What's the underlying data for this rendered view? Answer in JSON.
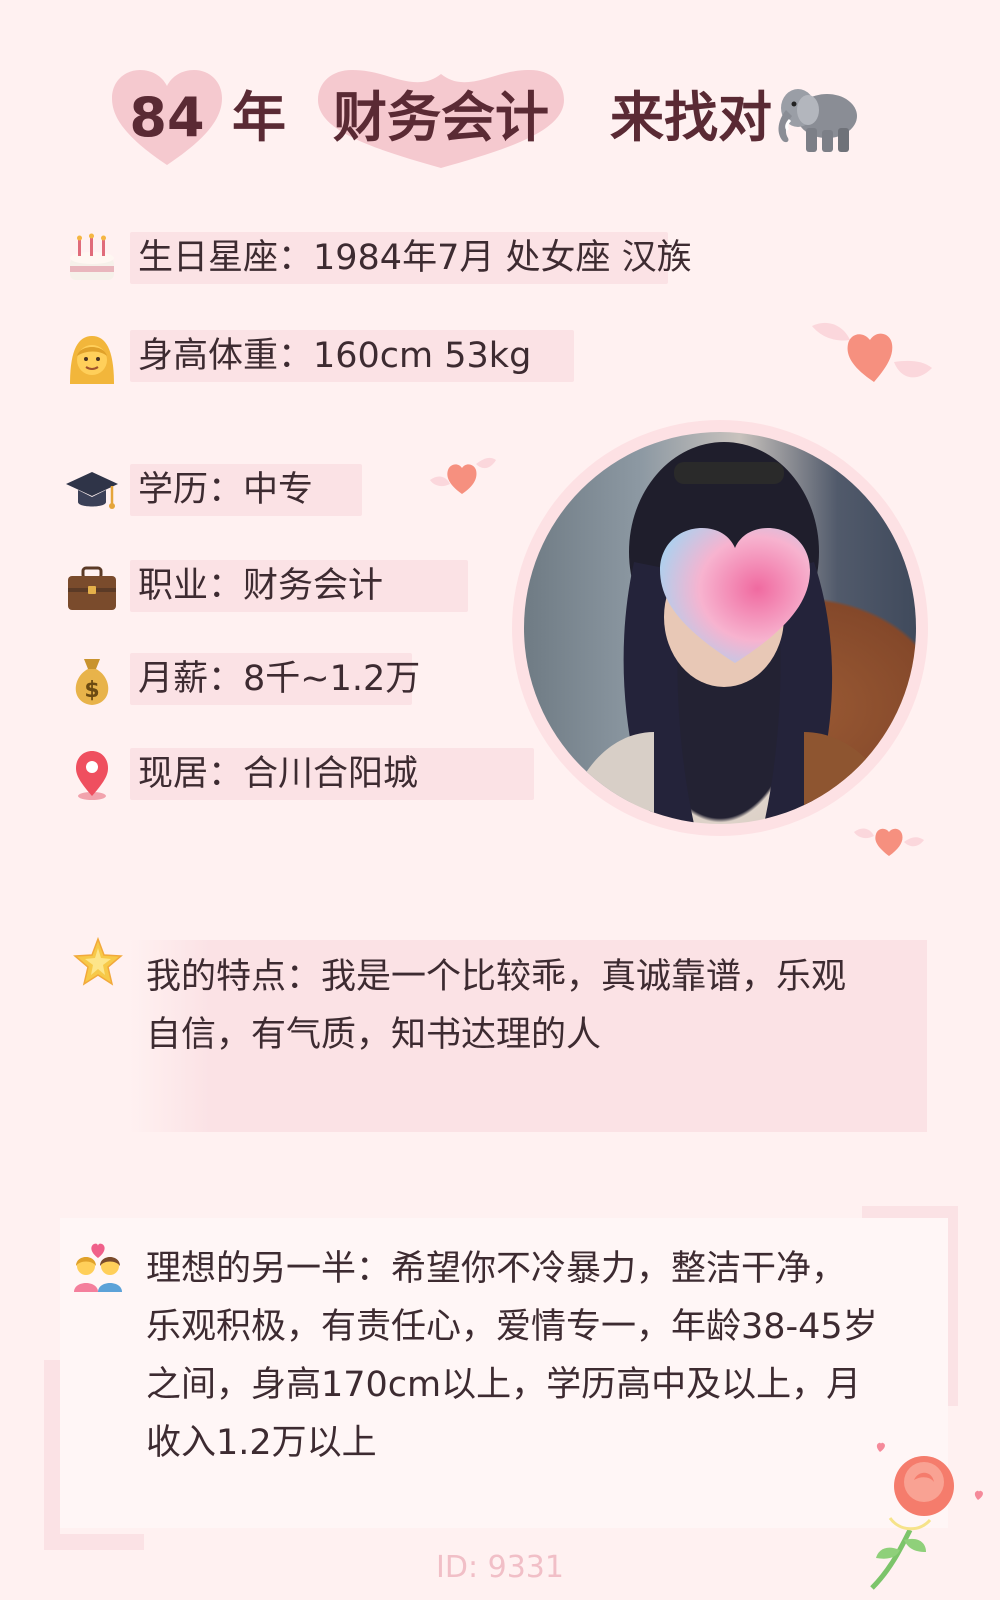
{
  "header": {
    "year": "84",
    "year_suffix": "年",
    "job": "财务会计",
    "tail": "来找对",
    "tail_icon": "elephant-icon"
  },
  "info": [
    {
      "icon": "birthday-cake-icon",
      "text": "生日星座：1984年7月 处女座 汉族"
    },
    {
      "icon": "woman-icon",
      "text": "身高体重：160cm 53kg"
    },
    {
      "icon": "graduation-cap-icon",
      "text": "学历：中专"
    },
    {
      "icon": "briefcase-icon",
      "text": "职业：财务会计"
    },
    {
      "icon": "money-bag-icon",
      "text": "月薪：8千~1.2万"
    },
    {
      "icon": "location-pin-icon",
      "text": "现居：合川合阳城"
    }
  ],
  "traits": {
    "icon": "star-icon",
    "line1": "我的特点：我是一个比较乖，真诚靠谱，乐观",
    "line2": "自信，有气质，知书达理的人"
  },
  "ideal": {
    "icon": "couple-with-heart-icon",
    "line1": "理想的另一半：希望你不冷暴力，整洁干净，",
    "line2": "乐观积极，有责任心，爱情专一，年龄38-45岁",
    "line3": "之间，身高170cm以上，学历高中及以上，月",
    "line4": "收入1.2万以上"
  },
  "footer": {
    "id": "ID: 9331"
  },
  "colors": {
    "background": "#fff1f1",
    "highlight": "#fbe2e5",
    "heart_badge": "#f5c9cf",
    "title_text": "#5a2a34"
  }
}
